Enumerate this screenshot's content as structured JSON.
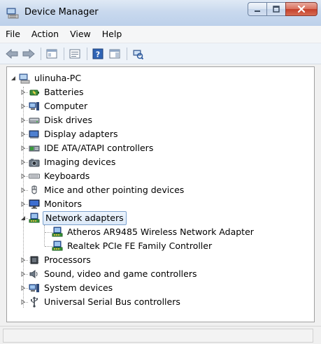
{
  "window": {
    "title": "Device Manager"
  },
  "menu": [
    "File",
    "Action",
    "View",
    "Help"
  ],
  "toolbar": {
    "buttons": [
      "back-icon",
      "forward-icon",
      "properties-pane-icon",
      "show-hide-tree-icon",
      "help-icon",
      "console-tree-icon",
      "scan-hardware-icon"
    ]
  },
  "tree": {
    "root": "ulinuha-PC",
    "categories": [
      {
        "label": "Batteries",
        "icon": "battery-icon"
      },
      {
        "label": "Computer",
        "icon": "computer-icon"
      },
      {
        "label": "Disk drives",
        "icon": "disk-drive-icon"
      },
      {
        "label": "Display adapters",
        "icon": "display-adapter-icon"
      },
      {
        "label": "IDE ATA/ATAPI controllers",
        "icon": "ide-controller-icon"
      },
      {
        "label": "Imaging devices",
        "icon": "imaging-device-icon"
      },
      {
        "label": "Keyboards",
        "icon": "keyboard-icon"
      },
      {
        "label": "Mice and other pointing devices",
        "icon": "mouse-icon"
      },
      {
        "label": "Monitors",
        "icon": "monitor-icon"
      },
      {
        "label": "Network adapters",
        "icon": "network-adapter-icon",
        "expanded": true,
        "selected": true
      },
      {
        "label": "Processors",
        "icon": "processor-icon"
      },
      {
        "label": "Sound, video and game controllers",
        "icon": "sound-icon"
      },
      {
        "label": "System devices",
        "icon": "system-device-icon"
      },
      {
        "label": "Universal Serial Bus controllers",
        "icon": "usb-icon"
      }
    ],
    "network_children": [
      {
        "label": "Atheros AR9485 Wireless Network Adapter",
        "icon": "network-adapter-icon"
      },
      {
        "label": "Realtek PCIe FE Family Controller",
        "icon": "network-adapter-icon"
      }
    ]
  },
  "colors": {
    "selection_border": "#7da2ce",
    "close_button": "#c4402a"
  }
}
